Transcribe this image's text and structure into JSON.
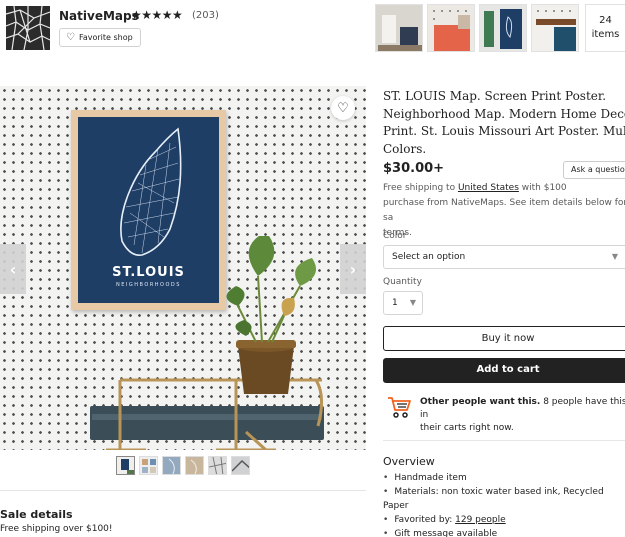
{
  "shop": {
    "name": "NativeMaps",
    "stars": "★★★★★",
    "review_count": "(203)",
    "favorite_label": "Favorite shop",
    "items_number": "24",
    "items_label": "items"
  },
  "listing": {
    "title_lines": [
      "ST. LOUIS Map. Screen Print Poster.",
      "Neighborhood Map. Modern Home Decor",
      "Print. St. Louis Missouri Art Poster. Multiple",
      "Colors."
    ],
    "price": "$30.00+",
    "ask_label": "Ask a question",
    "shipping_pre": "Free shipping to ",
    "shipping_link": "United States",
    "shipping_post": " with $100",
    "shipping_line2": "purchase from NativeMaps. See item details below for sa",
    "shipping_line3": "terms.",
    "color_label": "Color",
    "color_placeholder": "Select an option",
    "quantity_label": "Quantity",
    "quantity_value": "1",
    "buy_label": "Buy it now",
    "cart_label": "Add to cart",
    "demand_bold": "Other people want this.",
    "demand_text": " 8 people have this in",
    "demand_line2": "their carts right now."
  },
  "poster": {
    "city": "ST.LOUIS",
    "subtitle": "NEIGHBORHOODS"
  },
  "sale": {
    "title": "Sale details",
    "text": "Free shipping over $100!"
  },
  "overview": {
    "title": "Overview",
    "item1": "Handmade item",
    "item2": "Materials: non toxic water based ink, Recycled Paper",
    "item3_pre": "Favorited by: ",
    "item3_link": "129 people",
    "item4": "Gift message available"
  },
  "colors": {
    "poster_bg": "#1f3e66",
    "frame": "#e7c9a6",
    "cart_button": "#222222",
    "cart_icon": "#f1641e"
  }
}
